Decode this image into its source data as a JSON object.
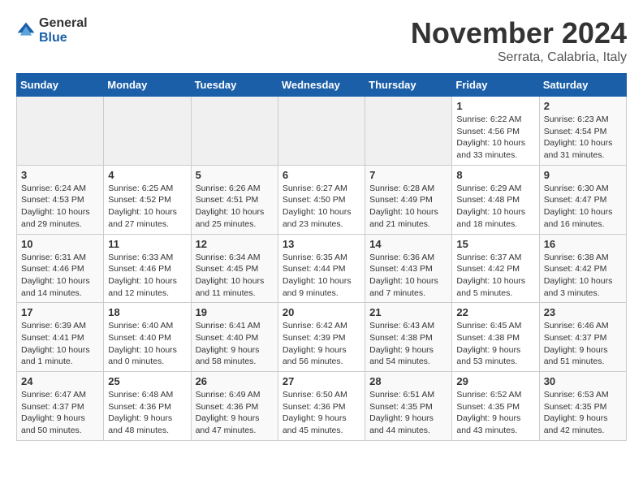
{
  "logo": {
    "general": "General",
    "blue": "Blue"
  },
  "title": "November 2024",
  "subtitle": "Serrata, Calabria, Italy",
  "weekdays": [
    "Sunday",
    "Monday",
    "Tuesday",
    "Wednesday",
    "Thursday",
    "Friday",
    "Saturday"
  ],
  "weeks": [
    [
      {
        "day": "",
        "info": ""
      },
      {
        "day": "",
        "info": ""
      },
      {
        "day": "",
        "info": ""
      },
      {
        "day": "",
        "info": ""
      },
      {
        "day": "",
        "info": ""
      },
      {
        "day": "1",
        "info": "Sunrise: 6:22 AM\nSunset: 4:56 PM\nDaylight: 10 hours and 33 minutes."
      },
      {
        "day": "2",
        "info": "Sunrise: 6:23 AM\nSunset: 4:54 PM\nDaylight: 10 hours and 31 minutes."
      }
    ],
    [
      {
        "day": "3",
        "info": "Sunrise: 6:24 AM\nSunset: 4:53 PM\nDaylight: 10 hours and 29 minutes."
      },
      {
        "day": "4",
        "info": "Sunrise: 6:25 AM\nSunset: 4:52 PM\nDaylight: 10 hours and 27 minutes."
      },
      {
        "day": "5",
        "info": "Sunrise: 6:26 AM\nSunset: 4:51 PM\nDaylight: 10 hours and 25 minutes."
      },
      {
        "day": "6",
        "info": "Sunrise: 6:27 AM\nSunset: 4:50 PM\nDaylight: 10 hours and 23 minutes."
      },
      {
        "day": "7",
        "info": "Sunrise: 6:28 AM\nSunset: 4:49 PM\nDaylight: 10 hours and 21 minutes."
      },
      {
        "day": "8",
        "info": "Sunrise: 6:29 AM\nSunset: 4:48 PM\nDaylight: 10 hours and 18 minutes."
      },
      {
        "day": "9",
        "info": "Sunrise: 6:30 AM\nSunset: 4:47 PM\nDaylight: 10 hours and 16 minutes."
      }
    ],
    [
      {
        "day": "10",
        "info": "Sunrise: 6:31 AM\nSunset: 4:46 PM\nDaylight: 10 hours and 14 minutes."
      },
      {
        "day": "11",
        "info": "Sunrise: 6:33 AM\nSunset: 4:46 PM\nDaylight: 10 hours and 12 minutes."
      },
      {
        "day": "12",
        "info": "Sunrise: 6:34 AM\nSunset: 4:45 PM\nDaylight: 10 hours and 11 minutes."
      },
      {
        "day": "13",
        "info": "Sunrise: 6:35 AM\nSunset: 4:44 PM\nDaylight: 10 hours and 9 minutes."
      },
      {
        "day": "14",
        "info": "Sunrise: 6:36 AM\nSunset: 4:43 PM\nDaylight: 10 hours and 7 minutes."
      },
      {
        "day": "15",
        "info": "Sunrise: 6:37 AM\nSunset: 4:42 PM\nDaylight: 10 hours and 5 minutes."
      },
      {
        "day": "16",
        "info": "Sunrise: 6:38 AM\nSunset: 4:42 PM\nDaylight: 10 hours and 3 minutes."
      }
    ],
    [
      {
        "day": "17",
        "info": "Sunrise: 6:39 AM\nSunset: 4:41 PM\nDaylight: 10 hours and 1 minute."
      },
      {
        "day": "18",
        "info": "Sunrise: 6:40 AM\nSunset: 4:40 PM\nDaylight: 10 hours and 0 minutes."
      },
      {
        "day": "19",
        "info": "Sunrise: 6:41 AM\nSunset: 4:40 PM\nDaylight: 9 hours and 58 minutes."
      },
      {
        "day": "20",
        "info": "Sunrise: 6:42 AM\nSunset: 4:39 PM\nDaylight: 9 hours and 56 minutes."
      },
      {
        "day": "21",
        "info": "Sunrise: 6:43 AM\nSunset: 4:38 PM\nDaylight: 9 hours and 54 minutes."
      },
      {
        "day": "22",
        "info": "Sunrise: 6:45 AM\nSunset: 4:38 PM\nDaylight: 9 hours and 53 minutes."
      },
      {
        "day": "23",
        "info": "Sunrise: 6:46 AM\nSunset: 4:37 PM\nDaylight: 9 hours and 51 minutes."
      }
    ],
    [
      {
        "day": "24",
        "info": "Sunrise: 6:47 AM\nSunset: 4:37 PM\nDaylight: 9 hours and 50 minutes."
      },
      {
        "day": "25",
        "info": "Sunrise: 6:48 AM\nSunset: 4:36 PM\nDaylight: 9 hours and 48 minutes."
      },
      {
        "day": "26",
        "info": "Sunrise: 6:49 AM\nSunset: 4:36 PM\nDaylight: 9 hours and 47 minutes."
      },
      {
        "day": "27",
        "info": "Sunrise: 6:50 AM\nSunset: 4:36 PM\nDaylight: 9 hours and 45 minutes."
      },
      {
        "day": "28",
        "info": "Sunrise: 6:51 AM\nSunset: 4:35 PM\nDaylight: 9 hours and 44 minutes."
      },
      {
        "day": "29",
        "info": "Sunrise: 6:52 AM\nSunset: 4:35 PM\nDaylight: 9 hours and 43 minutes."
      },
      {
        "day": "30",
        "info": "Sunrise: 6:53 AM\nSunset: 4:35 PM\nDaylight: 9 hours and 42 minutes."
      }
    ]
  ]
}
